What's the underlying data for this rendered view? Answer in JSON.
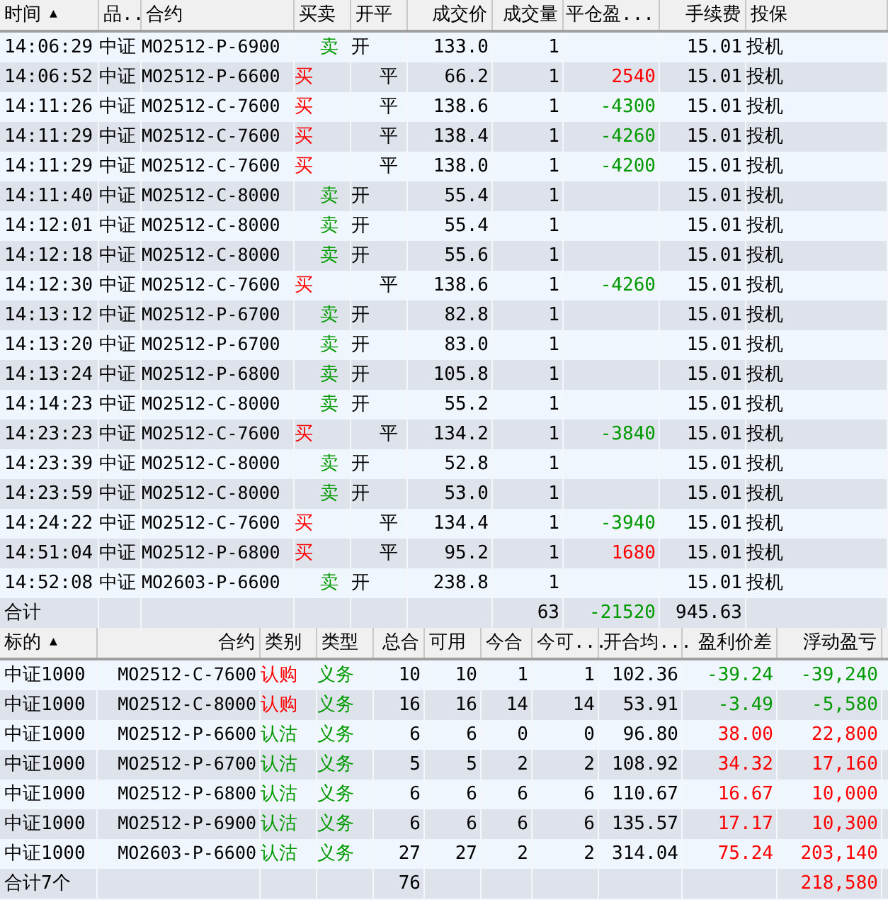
{
  "trades": {
    "columns": [
      {
        "label": "时间",
        "sort_mark": "▲"
      },
      {
        "label": "品.."
      },
      {
        "label": "合约"
      },
      {
        "label": "买卖"
      },
      {
        "label": "开平"
      },
      {
        "label": "成交价"
      },
      {
        "label": "成交量"
      },
      {
        "label": "平仓盈..."
      },
      {
        "label": "手续费"
      },
      {
        "label": "投保"
      }
    ],
    "rows": [
      {
        "time": "14:06:29",
        "product": "中证",
        "contract": "MO2512-P-6900",
        "side": {
          "text": "卖",
          "kind": "sell"
        },
        "offset": {
          "text": "开",
          "kind": "open"
        },
        "price": "133.0",
        "volume": "1",
        "fee": "15.01",
        "hedge": "投机"
      },
      {
        "time": "14:06:52",
        "product": "中证",
        "contract": "MO2512-P-6600",
        "side": {
          "text": "买",
          "kind": "buy"
        },
        "offset": {
          "text": "平",
          "kind": "close"
        },
        "price": "66.2",
        "volume": "1",
        "close_pnl": {
          "text": "2540",
          "kind": "gain"
        },
        "fee": "15.01",
        "hedge": "投机"
      },
      {
        "time": "14:11:26",
        "product": "中证",
        "contract": "MO2512-C-7600",
        "side": {
          "text": "买",
          "kind": "buy"
        },
        "offset": {
          "text": "平",
          "kind": "close"
        },
        "price": "138.6",
        "volume": "1",
        "close_pnl": {
          "text": "-4300",
          "kind": "loss"
        },
        "fee": "15.01",
        "hedge": "投机"
      },
      {
        "time": "14:11:29",
        "product": "中证",
        "contract": "MO2512-C-7600",
        "side": {
          "text": "买",
          "kind": "buy"
        },
        "offset": {
          "text": "平",
          "kind": "close"
        },
        "price": "138.4",
        "volume": "1",
        "close_pnl": {
          "text": "-4260",
          "kind": "loss"
        },
        "fee": "15.01",
        "hedge": "投机"
      },
      {
        "time": "14:11:29",
        "product": "中证",
        "contract": "MO2512-C-7600",
        "side": {
          "text": "买",
          "kind": "buy"
        },
        "offset": {
          "text": "平",
          "kind": "close"
        },
        "price": "138.0",
        "volume": "1",
        "close_pnl": {
          "text": "-4200",
          "kind": "loss"
        },
        "fee": "15.01",
        "hedge": "投机"
      },
      {
        "time": "14:11:40",
        "product": "中证",
        "contract": "MO2512-C-8000",
        "side": {
          "text": "卖",
          "kind": "sell"
        },
        "offset": {
          "text": "开",
          "kind": "open"
        },
        "price": "55.4",
        "volume": "1",
        "fee": "15.01",
        "hedge": "投机"
      },
      {
        "time": "14:12:01",
        "product": "中证",
        "contract": "MO2512-C-8000",
        "side": {
          "text": "卖",
          "kind": "sell"
        },
        "offset": {
          "text": "开",
          "kind": "open"
        },
        "price": "55.4",
        "volume": "1",
        "fee": "15.01",
        "hedge": "投机"
      },
      {
        "time": "14:12:18",
        "product": "中证",
        "contract": "MO2512-C-8000",
        "side": {
          "text": "卖",
          "kind": "sell"
        },
        "offset": {
          "text": "开",
          "kind": "open"
        },
        "price": "55.6",
        "volume": "1",
        "fee": "15.01",
        "hedge": "投机"
      },
      {
        "time": "14:12:30",
        "product": "中证",
        "contract": "MO2512-C-7600",
        "side": {
          "text": "买",
          "kind": "buy"
        },
        "offset": {
          "text": "平",
          "kind": "close"
        },
        "price": "138.6",
        "volume": "1",
        "close_pnl": {
          "text": "-4260",
          "kind": "loss"
        },
        "fee": "15.01",
        "hedge": "投机"
      },
      {
        "time": "14:13:12",
        "product": "中证",
        "contract": "MO2512-P-6700",
        "side": {
          "text": "卖",
          "kind": "sell"
        },
        "offset": {
          "text": "开",
          "kind": "open"
        },
        "price": "82.8",
        "volume": "1",
        "fee": "15.01",
        "hedge": "投机"
      },
      {
        "time": "14:13:20",
        "product": "中证",
        "contract": "MO2512-P-6700",
        "side": {
          "text": "卖",
          "kind": "sell"
        },
        "offset": {
          "text": "开",
          "kind": "open"
        },
        "price": "83.0",
        "volume": "1",
        "fee": "15.01",
        "hedge": "投机"
      },
      {
        "time": "14:13:24",
        "product": "中证",
        "contract": "MO2512-P-6800",
        "side": {
          "text": "卖",
          "kind": "sell"
        },
        "offset": {
          "text": "开",
          "kind": "open"
        },
        "price": "105.8",
        "volume": "1",
        "fee": "15.01",
        "hedge": "投机"
      },
      {
        "time": "14:14:23",
        "product": "中证",
        "contract": "MO2512-C-8000",
        "side": {
          "text": "卖",
          "kind": "sell"
        },
        "offset": {
          "text": "开",
          "kind": "open"
        },
        "price": "55.2",
        "volume": "1",
        "fee": "15.01",
        "hedge": "投机"
      },
      {
        "time": "14:23:23",
        "product": "中证",
        "contract": "MO2512-C-7600",
        "side": {
          "text": "买",
          "kind": "buy"
        },
        "offset": {
          "text": "平",
          "kind": "close"
        },
        "price": "134.2",
        "volume": "1",
        "close_pnl": {
          "text": "-3840",
          "kind": "loss"
        },
        "fee": "15.01",
        "hedge": "投机"
      },
      {
        "time": "14:23:39",
        "product": "中证",
        "contract": "MO2512-C-8000",
        "side": {
          "text": "卖",
          "kind": "sell"
        },
        "offset": {
          "text": "开",
          "kind": "open"
        },
        "price": "52.8",
        "volume": "1",
        "fee": "15.01",
        "hedge": "投机"
      },
      {
        "time": "14:23:59",
        "product": "中证",
        "contract": "MO2512-C-8000",
        "side": {
          "text": "卖",
          "kind": "sell"
        },
        "offset": {
          "text": "开",
          "kind": "open"
        },
        "price": "53.0",
        "volume": "1",
        "fee": "15.01",
        "hedge": "投机"
      },
      {
        "time": "14:24:22",
        "product": "中证",
        "contract": "MO2512-C-7600",
        "side": {
          "text": "买",
          "kind": "buy"
        },
        "offset": {
          "text": "平",
          "kind": "close"
        },
        "price": "134.4",
        "volume": "1",
        "close_pnl": {
          "text": "-3940",
          "kind": "loss"
        },
        "fee": "15.01",
        "hedge": "投机"
      },
      {
        "time": "14:51:04",
        "product": "中证",
        "contract": "MO2512-P-6800",
        "side": {
          "text": "买",
          "kind": "buy"
        },
        "offset": {
          "text": "平",
          "kind": "close"
        },
        "price": "95.2",
        "volume": "1",
        "close_pnl": {
          "text": "1680",
          "kind": "gain"
        },
        "fee": "15.01",
        "hedge": "投机"
      },
      {
        "time": "14:52:08",
        "product": "中证",
        "contract": "MO2603-P-6600",
        "side": {
          "text": "卖",
          "kind": "sell"
        },
        "offset": {
          "text": "开",
          "kind": "open"
        },
        "price": "238.8",
        "volume": "1",
        "fee": "15.01",
        "hedge": "投机"
      }
    ],
    "total": {
      "label": "合计",
      "volume": "63",
      "close_pnl": {
        "text": "-21520",
        "kind": "loss"
      },
      "fee": "945.63"
    }
  },
  "positions": {
    "columns": [
      {
        "label": "标的",
        "sort_mark": "▲"
      },
      {
        "label": "合约"
      },
      {
        "label": "类别"
      },
      {
        "label": "类型"
      },
      {
        "label": "总合"
      },
      {
        "label": "可用"
      },
      {
        "label": "今合"
      },
      {
        "label": "今可..."
      },
      {
        "label": "开合均..."
      },
      {
        "label": "盈利价差"
      },
      {
        "label": "浮动盈亏"
      }
    ],
    "rows": [
      {
        "underlying": "中证1000",
        "contract": "MO2512-C-7600",
        "category": {
          "text": "认购",
          "kind": "call"
        },
        "type": "义务",
        "total": "10",
        "available": "10",
        "today": "1",
        "today_available": "1",
        "open_avg": "102.36",
        "price_diff": {
          "text": "-39.24",
          "kind": "loss"
        },
        "float_pnl": {
          "text": "-39,240",
          "kind": "loss"
        }
      },
      {
        "underlying": "中证1000",
        "contract": "MO2512-C-8000",
        "category": {
          "text": "认购",
          "kind": "call"
        },
        "type": "义务",
        "total": "16",
        "available": "16",
        "today": "14",
        "today_available": "14",
        "open_avg": "53.91",
        "price_diff": {
          "text": "-3.49",
          "kind": "loss"
        },
        "float_pnl": {
          "text": "-5,580",
          "kind": "loss"
        }
      },
      {
        "underlying": "中证1000",
        "contract": "MO2512-P-6600",
        "category": {
          "text": "认沽",
          "kind": "put"
        },
        "type": "义务",
        "total": "6",
        "available": "6",
        "today": "0",
        "today_available": "0",
        "open_avg": "96.80",
        "price_diff": {
          "text": "38.00",
          "kind": "gain"
        },
        "float_pnl": {
          "text": "22,800",
          "kind": "gain"
        }
      },
      {
        "underlying": "中证1000",
        "contract": "MO2512-P-6700",
        "category": {
          "text": "认沽",
          "kind": "put"
        },
        "type": "义务",
        "total": "5",
        "available": "5",
        "today": "2",
        "today_available": "2",
        "open_avg": "108.92",
        "price_diff": {
          "text": "34.32",
          "kind": "gain"
        },
        "float_pnl": {
          "text": "17,160",
          "kind": "gain"
        }
      },
      {
        "underlying": "中证1000",
        "contract": "MO2512-P-6800",
        "category": {
          "text": "认沽",
          "kind": "put"
        },
        "type": "义务",
        "total": "6",
        "available": "6",
        "today": "6",
        "today_available": "6",
        "open_avg": "110.67",
        "price_diff": {
          "text": "16.67",
          "kind": "gain"
        },
        "float_pnl": {
          "text": "10,000",
          "kind": "gain"
        }
      },
      {
        "underlying": "中证1000",
        "contract": "MO2512-P-6900",
        "category": {
          "text": "认沽",
          "kind": "put"
        },
        "type": "义务",
        "total": "6",
        "available": "6",
        "today": "6",
        "today_available": "6",
        "open_avg": "135.57",
        "price_diff": {
          "text": "17.17",
          "kind": "gain"
        },
        "float_pnl": {
          "text": "10,300",
          "kind": "gain"
        }
      },
      {
        "underlying": "中证1000",
        "contract": "MO2603-P-6600",
        "category": {
          "text": "认沽",
          "kind": "put"
        },
        "type": "义务",
        "total": "27",
        "available": "27",
        "today": "2",
        "today_available": "2",
        "open_avg": "314.04",
        "price_diff": {
          "text": "75.24",
          "kind": "gain"
        },
        "float_pnl": {
          "text": "203,140",
          "kind": "gain"
        }
      }
    ],
    "total": {
      "label": "合计7个",
      "total": "76",
      "float_pnl": {
        "text": "218,580",
        "kind": "gain"
      }
    }
  }
}
